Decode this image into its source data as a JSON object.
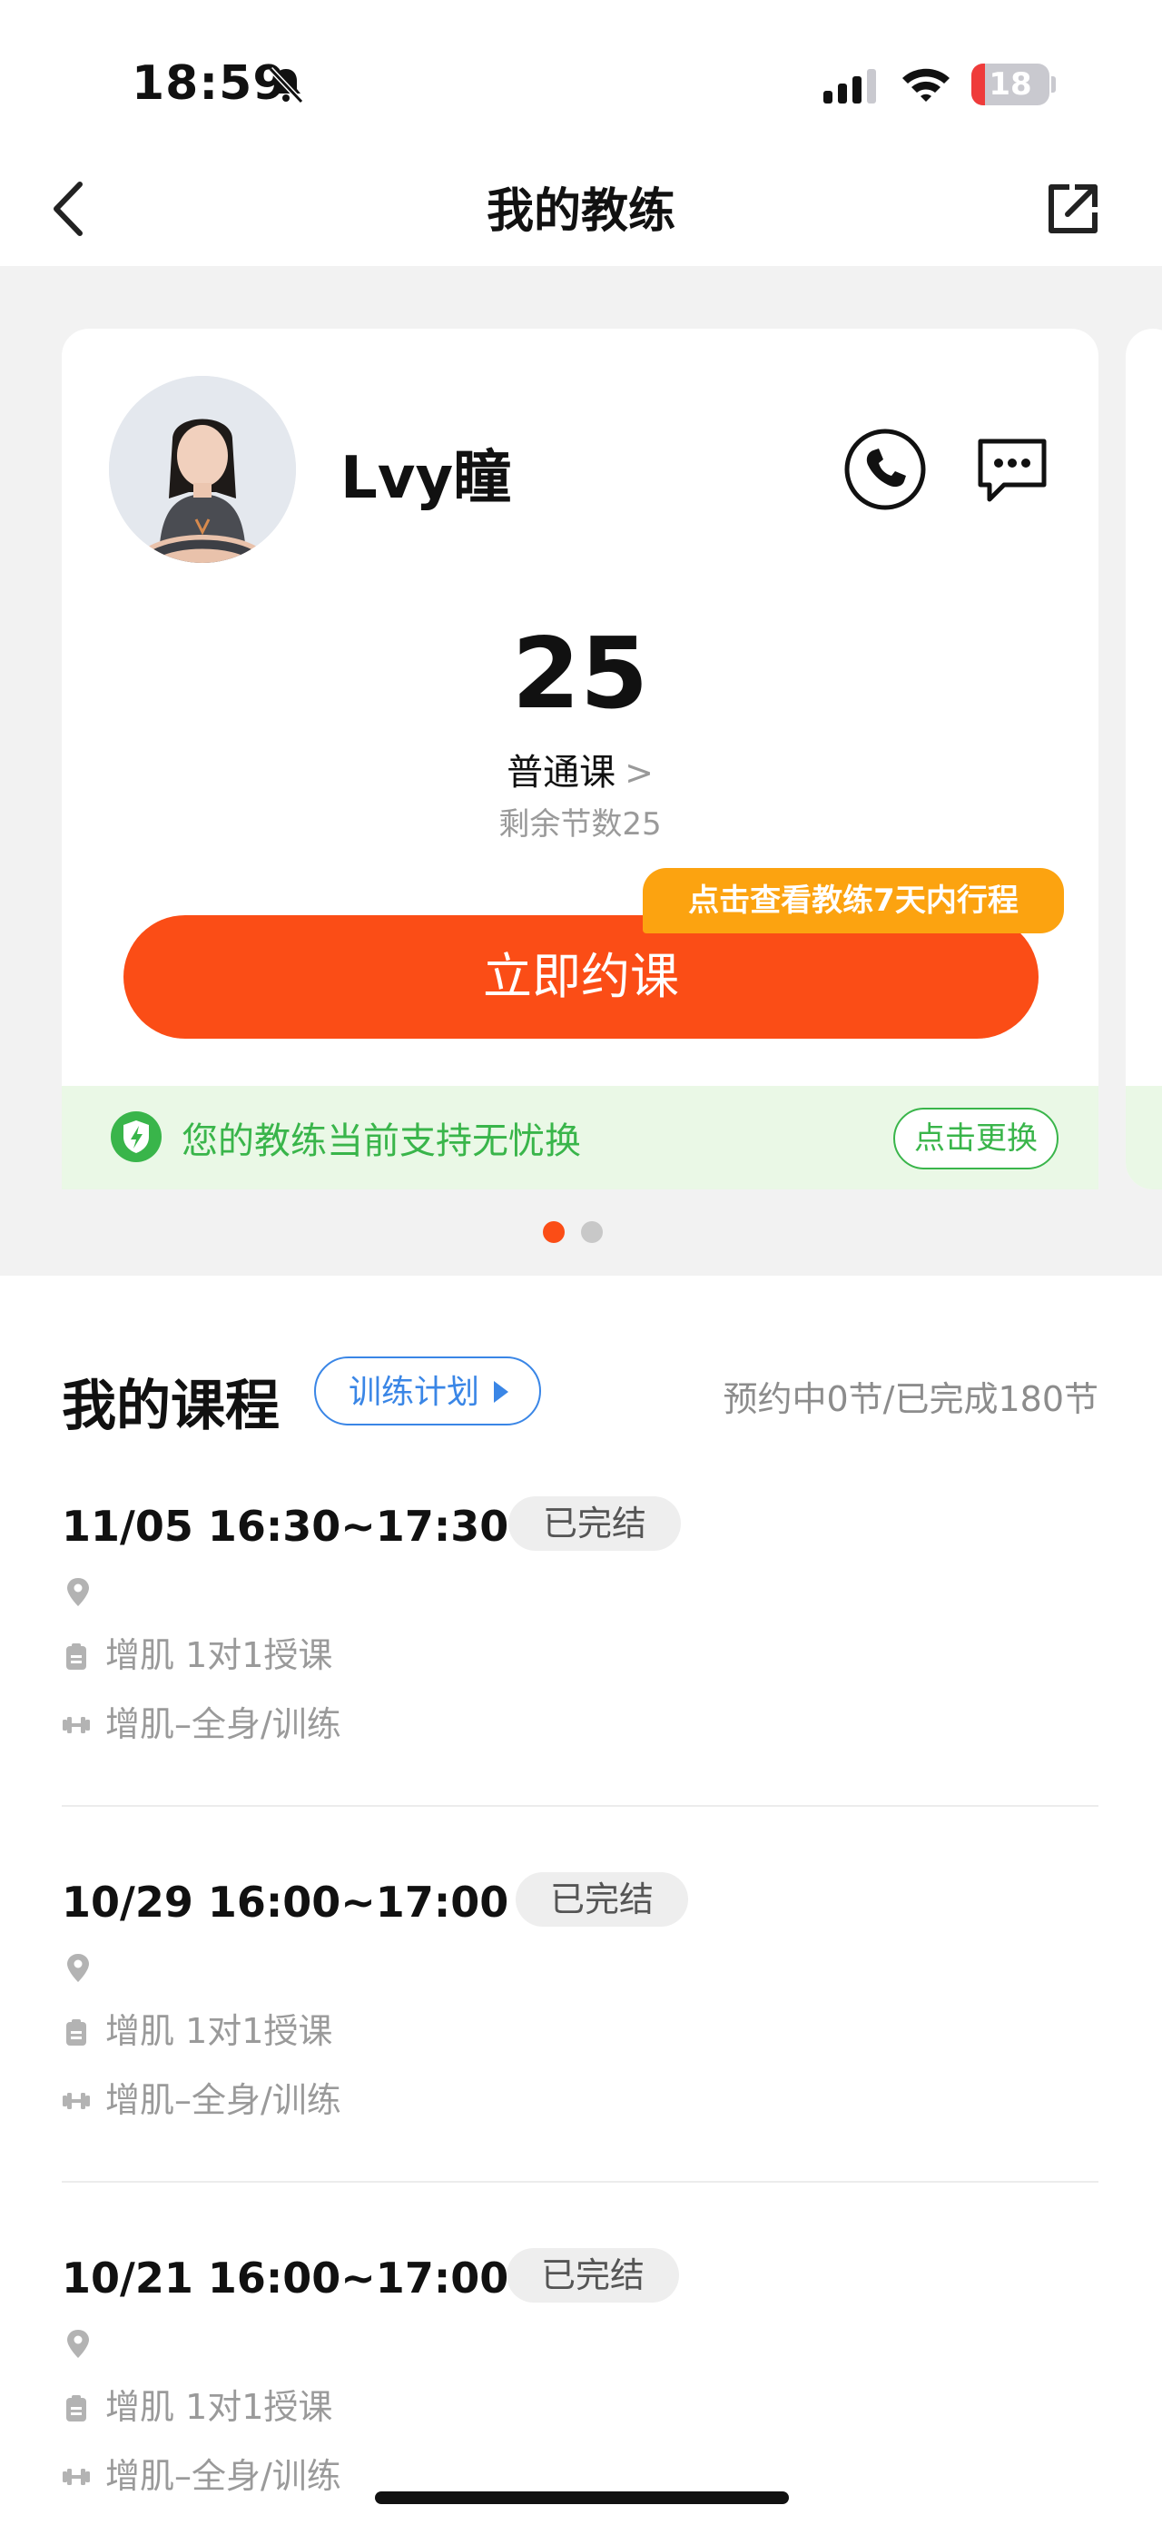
{
  "status_bar": {
    "time": "18:59",
    "battery": "18",
    "battery_level": 0.18
  },
  "nav": {
    "title": "我的教练"
  },
  "coach": {
    "name": "Lvy瞳",
    "lesson_count": "25",
    "lesson_type": "普通课",
    "remaining": "剩余节数25",
    "book_label": "立即约课",
    "schedule_badge": "点击查看教练7天内行程",
    "banner_text": "您的教练当前支持无忧换",
    "switch_label": "点击更换"
  },
  "carousel": {
    "pages": 2,
    "active": 1
  },
  "courses": {
    "title": "我的课程",
    "plan_label": "训练计划",
    "summary": "预约中0节/已完成180节",
    "items": [
      {
        "time": "11/05 16:30~17:30",
        "status": "已完结",
        "location": "",
        "type": "增肌 1对1授课",
        "content": "增肌–全身/训练"
      },
      {
        "time": "10/29 16:00~17:00",
        "status": "已完结",
        "location": "",
        "type": "增肌 1对1授课",
        "content": "增肌–全身/训练"
      },
      {
        "time": "10/21 16:00~17:00",
        "status": "已完结",
        "location": "",
        "type": "增肌 1对1授课",
        "content": "增肌–全身/训练"
      }
    ]
  },
  "colors": {
    "accent": "#fb4d16",
    "badge": "#fca310",
    "green": "#39b54a",
    "blue": "#3a86e6"
  },
  "icons": [
    "bell-slash-icon",
    "signal-icon",
    "wifi-icon",
    "back-chevron-icon",
    "share-icon",
    "phone-icon",
    "chat-icon",
    "shield-icon",
    "location-pin-icon",
    "clipboard-icon",
    "dumbbell-icon"
  ]
}
